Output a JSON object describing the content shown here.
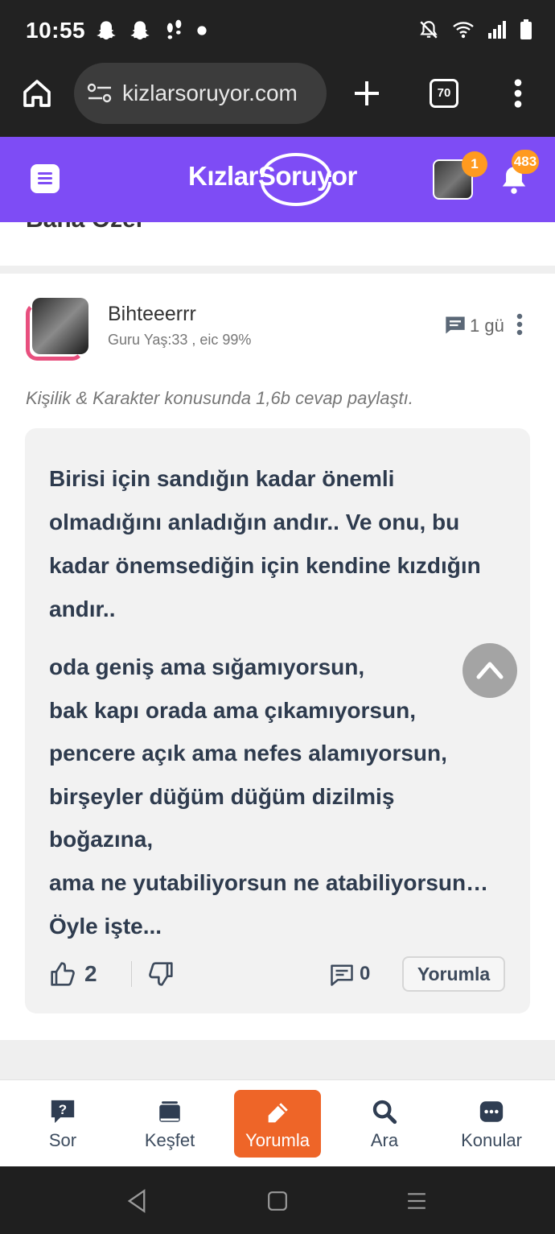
{
  "status_bar": {
    "time": "10:55",
    "icons_left": [
      "snapchat-ghost-icon",
      "snapchat-ghost-icon",
      "footsteps-icon",
      "dot-icon"
    ],
    "icons_right": [
      "do-not-disturb-icon",
      "wifi-icon",
      "signal-icon",
      "battery-icon"
    ]
  },
  "browser": {
    "url": "kizlarsoruyor.com",
    "tab_count": "70"
  },
  "site_header": {
    "logo": "KızlarSoruyor",
    "avatar_badge": "1",
    "notification_badge": "483"
  },
  "top_card": {
    "title": "Bana Özel"
  },
  "post": {
    "author": "Bihteeerrr",
    "meta": "Guru Yaş:33 , eic 99%",
    "time": "1 gü",
    "topic_line": "Kişilik & Karakter konusunda 1,6b cevap paylaştı.",
    "paragraph1": [
      "Birisi için sandığın kadar önemli",
      "olmadığını anladığın andır.. Ve onu, bu",
      "kadar önemsediğin için kendine kızdığın",
      "andır.."
    ],
    "paragraph2": [
      "oda geniş ama sığamıyorsun,",
      "bak kapı orada ama çıkamıyorsun,",
      "pencere açık ama nefes alamıyorsun,",
      "birşeyler düğüm düğüm dizilmiş",
      "boğazına,",
      "ama ne yutabiliyorsun ne atabiliyorsun…",
      "Öyle işte..."
    ],
    "likes": "2",
    "comments": "0",
    "comment_button": "Yorumla"
  },
  "bottom_nav": {
    "items": [
      {
        "label": "Sor",
        "icon": "question-bubble-icon"
      },
      {
        "label": "Keşfet",
        "icon": "stack-icon"
      },
      {
        "label": "Yorumla",
        "icon": "pencil-icon"
      },
      {
        "label": "Ara",
        "icon": "search-icon"
      },
      {
        "label": "Konular",
        "icon": "dots-bubble-icon"
      }
    ]
  },
  "colors": {
    "brand_purple": "#7e4cf5",
    "accent_orange": "#ee6528",
    "badge_orange": "#ff9a1f",
    "text_dark": "#2e3b4e"
  }
}
